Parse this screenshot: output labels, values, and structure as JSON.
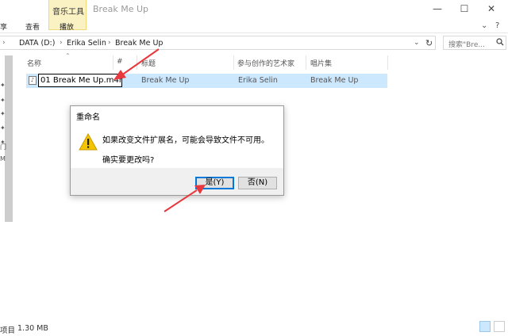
{
  "window": {
    "title": "Break Me Up",
    "context_tab": "音乐工具",
    "controls": {
      "minimize": "—",
      "maximize": "☐",
      "close": "✕"
    }
  },
  "ribbon": {
    "tabs": [
      "享",
      "查看",
      "播放"
    ],
    "collapse": "⌄",
    "help": "?"
  },
  "address": {
    "back": "›",
    "crumbs": [
      "DATA (D:)",
      "Erika Selin",
      "Break Me Up"
    ],
    "separator": "›",
    "dropdown": "⌄",
    "refresh": "↻"
  },
  "search": {
    "placeholder": "搜索\"Bre...",
    "icon": "search-icon"
  },
  "columns": {
    "name": "名称",
    "number": "#",
    "title": "标题",
    "artist": "参与创作的艺术家",
    "album": "唱片集"
  },
  "file": {
    "name": "01 Break Me Up.m4r",
    "title": "Break Me Up",
    "artist": "Erika Selin",
    "album": "Break Me Up"
  },
  "nav_glyphs": [
    "✦",
    "✦",
    "✦",
    "✦",
    "✦",
    "门",
    "M"
  ],
  "dialog": {
    "title": "重命名",
    "message": "如果改变文件扩展名，可能会导致文件不可用。",
    "question": "确实要更改吗?",
    "yes_label": "是(Y)",
    "no_label": "否(N)"
  },
  "status": {
    "items": "项目",
    "size": "1.30 MB"
  },
  "colors": {
    "accent": "#0078d7",
    "selection": "#cce8ff",
    "arrow": "#e8383d",
    "warning": "#f5c400"
  }
}
